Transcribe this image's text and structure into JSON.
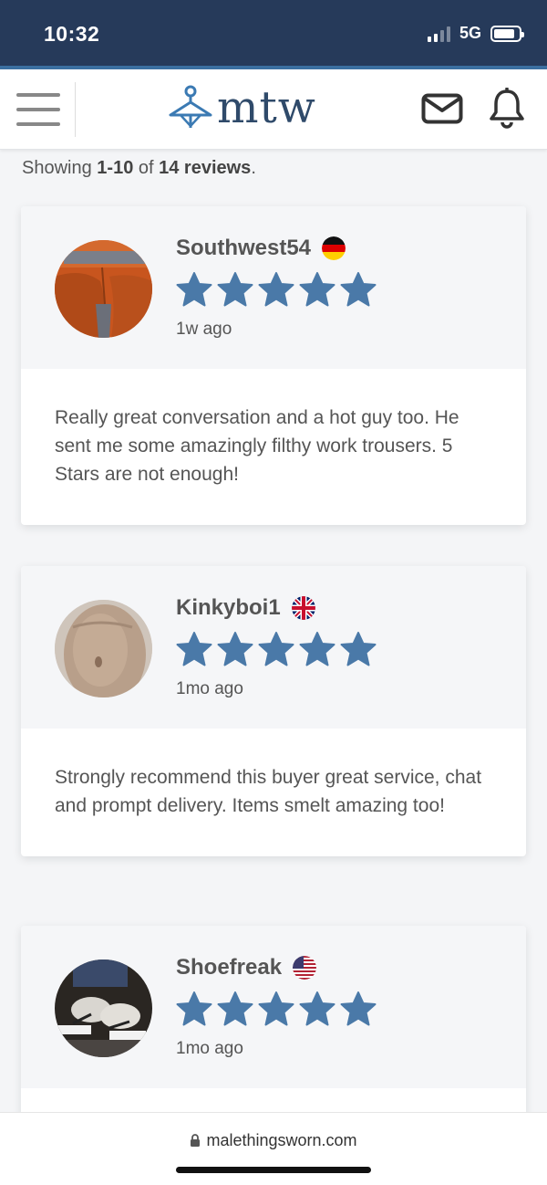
{
  "status_bar": {
    "time": "10:32",
    "network": "5G"
  },
  "header": {
    "logo_text": "mtw"
  },
  "summary": {
    "prefix": "Showing ",
    "range": "1-10",
    "middle": " of ",
    "total": "14 reviews",
    "suffix": "."
  },
  "reviews": [
    {
      "name": "Southwest54",
      "country_flag": "germany",
      "rating": 5,
      "time_ago": "1w ago",
      "text": "Really great conversation and a hot guy too. He sent me some amazingly filthy work trousers. 5 Stars are not enough!"
    },
    {
      "name": "Kinkyboi1",
      "country_flag": "united-kingdom",
      "rating": 5,
      "time_ago": "1mo ago",
      "text": "Strongly recommend this buyer great service, chat and prompt delivery. Items smelt amazing too!"
    },
    {
      "name": "Shoefreak",
      "country_flag": "united-states",
      "rating": 5,
      "time_ago": "1mo ago",
      "text": ""
    }
  ],
  "browser": {
    "url": "malethingsworn.com"
  },
  "colors": {
    "star": "#4a79a8",
    "status_bar": "#263a5a",
    "logo": "#2f4a6a"
  }
}
